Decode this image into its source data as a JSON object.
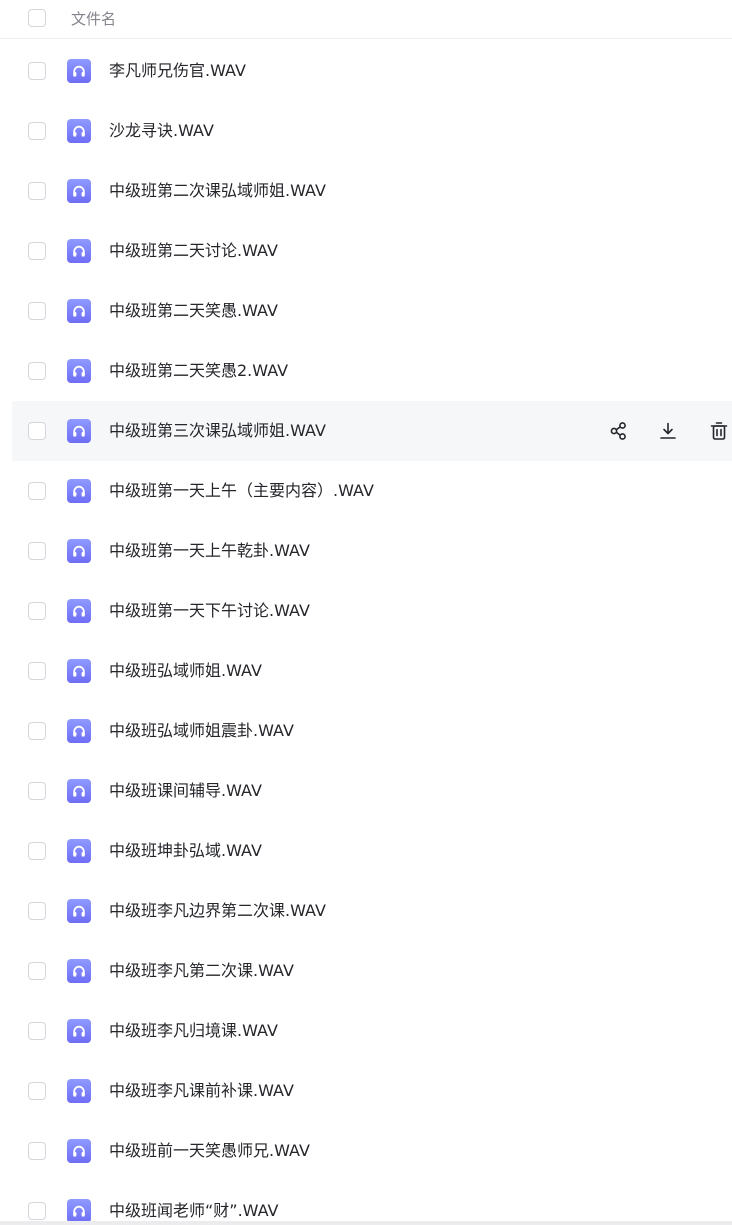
{
  "header": {
    "column_label": "文件名"
  },
  "files": [
    {
      "name": "李凡师兄伤官.WAV"
    },
    {
      "name": "沙龙寻诀.WAV"
    },
    {
      "name": "中级班第二次课弘域师姐.WAV"
    },
    {
      "name": "中级班第二天讨论.WAV"
    },
    {
      "name": "中级班第二天笑愚.WAV"
    },
    {
      "name": "中级班第二天笑愚2.WAV"
    },
    {
      "name": "中级班第三次课弘域师姐.WAV",
      "hovered": true
    },
    {
      "name": "中级班第一天上午（主要内容）.WAV"
    },
    {
      "name": "中级班第一天上午乾卦.WAV"
    },
    {
      "name": "中级班第一天下午讨论.WAV"
    },
    {
      "name": "中级班弘域师姐.WAV"
    },
    {
      "name": "中级班弘域师姐震卦.WAV"
    },
    {
      "name": "中级班课间辅导.WAV"
    },
    {
      "name": "中级班坤卦弘域.WAV"
    },
    {
      "name": "中级班李凡边界第二次课.WAV"
    },
    {
      "name": "中级班李凡第二次课.WAV"
    },
    {
      "name": "中级班李凡归境课.WAV"
    },
    {
      "name": "中级班李凡课前补课.WAV"
    },
    {
      "name": "中级班前一天笑愚师兄.WAV"
    },
    {
      "name": "中级班闻老师“财”.WAV"
    }
  ],
  "row_actions": [
    "share-icon",
    "download-icon",
    "delete-icon"
  ],
  "icons": {
    "audio_file": "headphones-icon"
  },
  "colors": {
    "audio_icon_top": "#8f9bff",
    "audio_icon_bottom": "#6e6df5",
    "hover_row": "#f6f7f9",
    "text": "#25262b",
    "muted_text": "#84858d"
  }
}
